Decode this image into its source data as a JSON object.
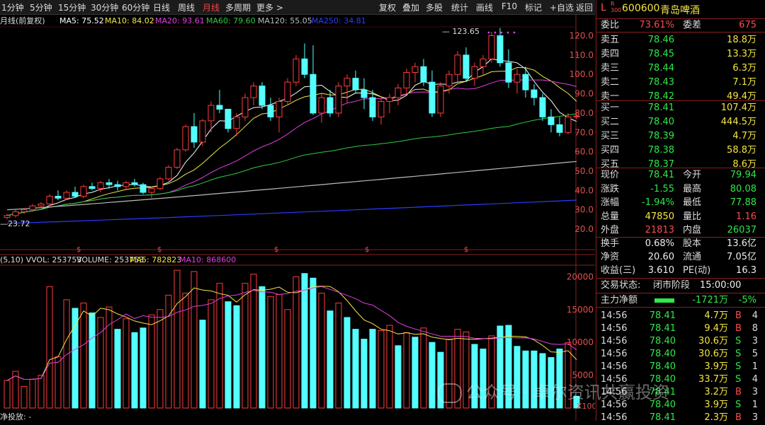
{
  "toolbar": {
    "left": [
      "1分钟",
      "5分钟",
      "15分钟",
      "30分钟",
      "60分钟",
      "日线",
      "周线",
      "月线",
      "多周期",
      "更多 >"
    ],
    "active": "月线",
    "right": [
      "复权",
      "叠加",
      "多股",
      "统计",
      "画线",
      "F10",
      "标记",
      "+自选",
      "返回"
    ]
  },
  "indicators": {
    "period": "月线(前复权)",
    "ma5": "MA5: 75.52",
    "ma10": "MA10: 84.02",
    "ma20": "MA20: 93.61",
    "ma60": "MA60: 79.60",
    "ma120": "MA120: 55.05",
    "ma250": "MA250: 34.81",
    "ma_colors": [
      "#ffffff",
      "#f5e642",
      "#e040e0",
      "#2ecc40",
      "#bbbbbb",
      "#2a3dff"
    ],
    "high_label": "123.65",
    "low_label": "23.72",
    "vol_header": [
      "(5,10) VVOL: 253753",
      "VOLUME: 253753",
      "MA5: 782823",
      "MA10: 868600"
    ],
    "vol_unit": "X100",
    "bottom_label": "净投放: -"
  },
  "price_axis": [
    "120.0",
    "110.0",
    "100.0",
    "90.0",
    "80.0",
    "70.0",
    "60.0",
    "50.0",
    "40.0",
    "30.0",
    "20.0"
  ],
  "vol_axis": [
    "20000",
    "15000",
    "10000",
    "5000"
  ],
  "chart_data": {
    "type": "candlestick",
    "price_ylim": [
      20,
      130
    ],
    "vol_ylim": [
      0,
      22000
    ],
    "candles": [
      [
        26,
        28,
        25,
        27
      ],
      [
        27,
        30,
        26,
        29
      ],
      [
        29,
        31,
        28,
        30
      ],
      [
        30,
        33,
        29,
        32
      ],
      [
        32,
        34,
        31,
        33
      ],
      [
        33,
        38,
        32,
        37
      ],
      [
        37,
        40,
        35,
        36
      ],
      [
        36,
        40,
        35,
        39
      ],
      [
        39,
        42,
        36,
        37
      ],
      [
        37,
        43,
        36,
        42
      ],
      [
        42,
        44,
        40,
        41
      ],
      [
        41,
        45,
        39,
        44
      ],
      [
        44,
        46,
        41,
        43
      ],
      [
        43,
        45,
        40,
        42
      ],
      [
        42,
        45,
        40,
        44
      ],
      [
        44,
        46,
        42,
        43
      ],
      [
        43,
        44,
        38,
        39
      ],
      [
        39,
        42,
        36,
        41
      ],
      [
        41,
        47,
        40,
        46
      ],
      [
        46,
        53,
        45,
        52
      ],
      [
        52,
        62,
        51,
        61
      ],
      [
        61,
        74,
        60,
        73
      ],
      [
        73,
        80,
        62,
        65
      ],
      [
        65,
        77,
        63,
        76
      ],
      [
        76,
        86,
        70,
        84
      ],
      [
        84,
        92,
        80,
        82
      ],
      [
        82,
        79,
        70,
        72
      ],
      [
        72,
        80,
        68,
        78
      ],
      [
        78,
        90,
        76,
        88
      ],
      [
        88,
        96,
        84,
        94
      ],
      [
        94,
        96,
        82,
        84
      ],
      [
        84,
        88,
        76,
        78
      ],
      [
        78,
        88,
        70,
        86
      ],
      [
        86,
        98,
        84,
        96
      ],
      [
        96,
        110,
        94,
        108
      ],
      [
        108,
        116,
        98,
        100
      ],
      [
        100,
        115,
        79,
        80
      ],
      [
        80,
        90,
        75,
        88
      ],
      [
        88,
        92,
        78,
        80
      ],
      [
        80,
        96,
        78,
        94
      ],
      [
        94,
        100,
        85,
        98
      ],
      [
        98,
        102,
        90,
        92
      ],
      [
        92,
        98,
        82,
        88
      ],
      [
        88,
        92,
        76,
        78
      ],
      [
        78,
        88,
        74,
        86
      ],
      [
        86,
        90,
        80,
        88
      ],
      [
        88,
        95,
        84,
        93
      ],
      [
        93,
        103,
        90,
        101
      ],
      [
        101,
        106,
        96,
        104
      ],
      [
        104,
        108,
        94,
        96
      ],
      [
        96,
        102,
        78,
        80
      ],
      [
        80,
        96,
        78,
        94
      ],
      [
        94,
        102,
        90,
        100
      ],
      [
        100,
        112,
        96,
        110
      ],
      [
        110,
        114,
        96,
        98
      ],
      [
        98,
        106,
        94,
        104
      ],
      [
        104,
        110,
        100,
        108
      ],
      [
        108,
        122,
        106,
        120
      ],
      [
        120,
        124,
        104,
        106
      ],
      [
        106,
        113,
        93,
        96
      ],
      [
        96,
        103,
        90,
        100
      ],
      [
        100,
        104,
        88,
        92
      ],
      [
        92,
        95,
        84,
        88
      ],
      [
        88,
        90,
        76,
        78
      ],
      [
        78,
        82,
        70,
        74
      ],
      [
        74,
        78,
        68,
        70
      ],
      [
        70,
        80,
        69,
        78
      ],
      [
        78,
        80,
        77,
        78.41
      ]
    ],
    "volumes": [
      [
        4200,
        0
      ],
      [
        5600,
        0
      ],
      [
        3300,
        0
      ],
      [
        4400,
        0
      ],
      [
        5000,
        0
      ],
      [
        18500,
        0
      ],
      [
        7800,
        0
      ],
      [
        16500,
        0
      ],
      [
        15200,
        1
      ],
      [
        16000,
        0
      ],
      [
        14500,
        1
      ],
      [
        13800,
        0
      ],
      [
        15400,
        0
      ],
      [
        12000,
        1
      ],
      [
        13600,
        0
      ],
      [
        11500,
        1
      ],
      [
        12200,
        1
      ],
      [
        14200,
        0
      ],
      [
        15000,
        0
      ],
      [
        17200,
        0
      ],
      [
        21000,
        0
      ],
      [
        17500,
        0
      ],
      [
        20800,
        0
      ],
      [
        13400,
        1
      ],
      [
        16500,
        0
      ],
      [
        19000,
        0
      ],
      [
        16200,
        1
      ],
      [
        15600,
        1
      ],
      [
        19000,
        0
      ],
      [
        20400,
        0
      ],
      [
        18500,
        1
      ],
      [
        17000,
        0
      ],
      [
        17300,
        0
      ],
      [
        15000,
        0
      ],
      [
        20000,
        0
      ],
      [
        20500,
        1
      ],
      [
        19800,
        1
      ],
      [
        17500,
        0
      ],
      [
        14800,
        1
      ],
      [
        16000,
        0
      ],
      [
        13800,
        1
      ],
      [
        12000,
        1
      ],
      [
        10500,
        1
      ],
      [
        12000,
        1
      ],
      [
        11800,
        0
      ],
      [
        12600,
        0
      ],
      [
        9500,
        1
      ],
      [
        11500,
        0
      ],
      [
        10800,
        1
      ],
      [
        12200,
        0
      ],
      [
        10000,
        1
      ],
      [
        8500,
        1
      ],
      [
        10500,
        0
      ],
      [
        12000,
        0
      ],
      [
        11600,
        0
      ],
      [
        9700,
        1
      ],
      [
        9000,
        1
      ],
      [
        11000,
        0
      ],
      [
        12500,
        1
      ],
      [
        12600,
        1
      ],
      [
        9400,
        1
      ],
      [
        8700,
        1
      ],
      [
        8700,
        1
      ],
      [
        8300,
        1
      ],
      [
        7700,
        1
      ],
      [
        9000,
        1
      ],
      [
        10000,
        0
      ],
      [
        1800,
        1
      ]
    ]
  },
  "panel": {
    "code": "600600",
    "name": "青岛啤酒",
    "weibi": {
      "label": "委比",
      "value": "73.61%",
      "label2": "委差",
      "value2": "675"
    },
    "asks": [
      {
        "label": "卖五",
        "price": "78.46",
        "vol": "18.8万"
      },
      {
        "label": "卖四",
        "price": "78.45",
        "vol": "13.3万"
      },
      {
        "label": "卖三",
        "price": "78.44",
        "vol": "6.3万"
      },
      {
        "label": "卖二",
        "price": "78.43",
        "vol": "7.1万"
      },
      {
        "label": "卖一",
        "price": "78.42",
        "vol": "49.4万"
      }
    ],
    "bids": [
      {
        "label": "买一",
        "price": "78.41",
        "vol": "107.4万"
      },
      {
        "label": "买二",
        "price": "78.40",
        "vol": "444.5万"
      },
      {
        "label": "买三",
        "price": "78.39",
        "vol": "4.7万"
      },
      {
        "label": "买四",
        "price": "78.38",
        "vol": "58.8万"
      },
      {
        "label": "买五",
        "price": "78.37",
        "vol": "8.6万"
      }
    ],
    "stats": [
      {
        "l1": "现价",
        "v1": "78.41",
        "c1": "green",
        "l2": "今开",
        "v2": "79.94",
        "c2": "green"
      },
      {
        "l1": "涨跌",
        "v1": "-1.55",
        "c1": "green",
        "l2": "最高",
        "v2": "80.08",
        "c2": "green"
      },
      {
        "l1": "涨幅",
        "v1": "-1.94%",
        "c1": "green",
        "l2": "最低",
        "v2": "77.88",
        "c2": "green"
      },
      {
        "l1": "总量",
        "v1": "47850",
        "c1": "yellow",
        "l2": "量比",
        "v2": "1.16",
        "c2": "red"
      },
      {
        "l1": "外盘",
        "v1": "21813",
        "c1": "red",
        "l2": "内盘",
        "v2": "26037",
        "c2": "green"
      }
    ],
    "stats2": [
      {
        "l1": "换手",
        "v1": "0.68%",
        "l2": "股本",
        "v2": "13.6亿"
      },
      {
        "l1": "净资",
        "v1": "20.60",
        "l2": "流通",
        "v2": "7.05亿"
      },
      {
        "l1": "收益(三)",
        "v1": "3.610",
        "l2": "PE(动)",
        "v2": "16.3"
      }
    ],
    "status_label": "交易状态:",
    "status_value": "闭市阶段",
    "status_time": "15:00:00",
    "flow_label": "主力净额",
    "flow_value": "-1721万",
    "flow_pct": "-5%",
    "ticks": [
      {
        "t": "14:56",
        "p": "78.41",
        "v": "4.7万",
        "s": "B",
        "n": "4"
      },
      {
        "t": "14:56",
        "p": "78.41",
        "v": "9.4万",
        "s": "B",
        "n": "8"
      },
      {
        "t": "14:56",
        "p": "78.40",
        "v": "30.6万",
        "s": "S",
        "n": "3"
      },
      {
        "t": "14:56",
        "p": "78.40",
        "v": "30.6万",
        "s": "S",
        "n": "5"
      },
      {
        "t": "14:56",
        "p": "78.40",
        "v": "3.9万",
        "s": "S",
        "n": "1"
      },
      {
        "t": "14:56",
        "p": "78.40",
        "v": "33.7万",
        "s": "S",
        "n": "4"
      },
      {
        "t": "14:56",
        "p": "78.41",
        "v": "3.2万",
        "s": "B",
        "n": "3"
      },
      {
        "t": "14:56",
        "p": "78.40",
        "v": "3.9万",
        "s": "S",
        "n": "1"
      },
      {
        "t": "14:56",
        "p": "78.41",
        "v": "2.3万",
        "s": "B",
        "n": "3"
      }
    ]
  },
  "watermark": "公众号 · 卓尔资讯共赢投资"
}
